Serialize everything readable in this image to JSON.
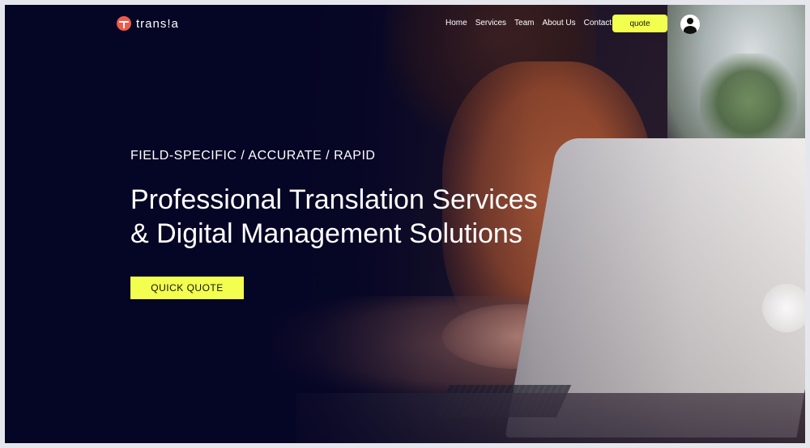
{
  "brand": {
    "name": "trans!a",
    "accent": "#f05a4a"
  },
  "nav": {
    "items": [
      {
        "label": "Home"
      },
      {
        "label": "Services"
      },
      {
        "label": "Team"
      },
      {
        "label": "About Us"
      },
      {
        "label": "Contact"
      }
    ],
    "quote_label": "quote",
    "account_icon": "user-circle-icon"
  },
  "hero": {
    "tagline": "FIELD-SPECIFIC / ACCURATE / RAPID",
    "headline_line1": "Professional Translation Services",
    "headline_line2": "& Digital Management Solutions",
    "cta_label": "QUICK QUOTE"
  },
  "colors": {
    "background": "#050525",
    "button": "#f3ff4f",
    "text": "#ffffff"
  }
}
